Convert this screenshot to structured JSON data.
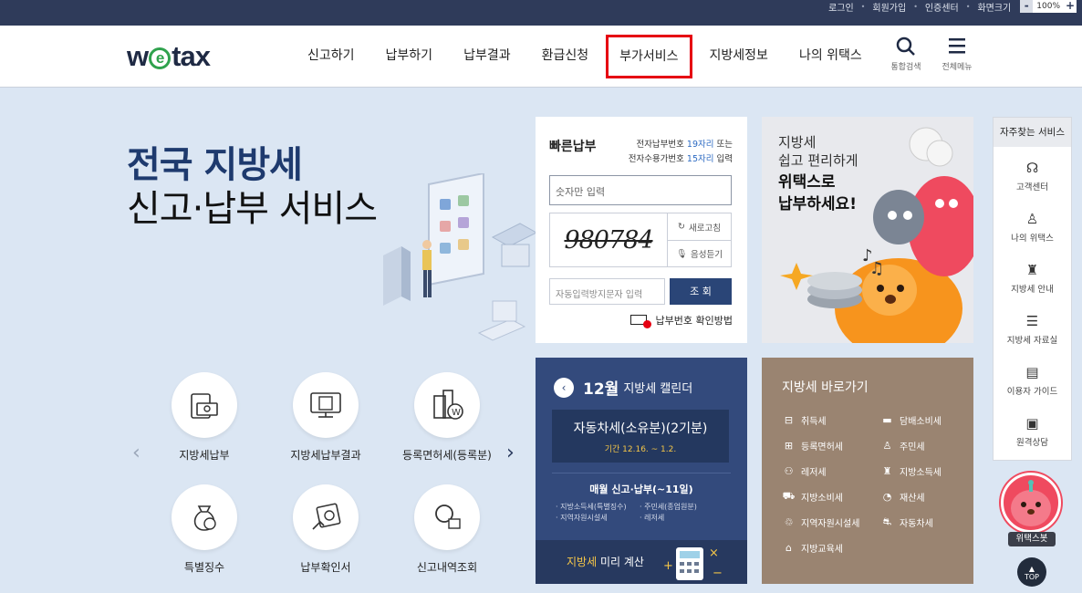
{
  "util_links": [
    "로그인",
    "회원가입",
    "인증센터",
    "화면크기"
  ],
  "zoom": {
    "minus": "-",
    "value": "100%",
    "plus": "+"
  },
  "logo": {
    "pre": "w",
    "e": "e",
    "post": "tax"
  },
  "nav": [
    "신고하기",
    "납부하기",
    "납부결과",
    "환급신청",
    "부가서비스",
    "지방세정보",
    "나의 위택스"
  ],
  "tools": {
    "search": "통합검색",
    "menu": "전체메뉴"
  },
  "hero": {
    "line1": "전국 지방세",
    "line2": "신고·납부 서비스"
  },
  "services": [
    "지방세납부",
    "지방세납부결과",
    "등록면허세(등록분)",
    "특별징수",
    "납부확인서",
    "신고내역조회"
  ],
  "quickpay": {
    "title": "빠른납부",
    "note1_pre": "전자납부번호 ",
    "note1_num": "19자리",
    "note1_post": " 또는",
    "note2_pre": "전자수용가번호 ",
    "note2_num": "15자리",
    "note2_post": " 입력",
    "input_placeholder": "숫자만 입력",
    "captcha_text": "980784",
    "refresh": "새로고침",
    "audio": "음성듣기",
    "captcha_placeholder": "자동입력방지문자 입력",
    "submit": "조 회",
    "help": "납부번호 확인방법"
  },
  "promo": {
    "line1": "지방세",
    "line2": "쉽고 편리하게",
    "line3": "위택스로",
    "line4": "납부하세요!"
  },
  "calendar": {
    "month": "12월",
    "title": "지방세 캘린더",
    "event_name": "자동차세(소유분)(2기분)",
    "event_period": "기간 12.16. ~ 1.2.",
    "monthly": "매월 신고·납부(~11일)",
    "items": [
      "지방소득세(특별징수)",
      "주민세(종업원분)",
      "지역자원시설세",
      "레저세"
    ],
    "footer_pre": "지방세",
    "footer_post": " 미리 계산"
  },
  "shortcut": {
    "title": "지방세 바로가기",
    "items": [
      "취득세",
      "담배소비세",
      "등록면허세",
      "주민세",
      "레저세",
      "지방소득세",
      "지방소비세",
      "재산세",
      "지역자원시설세",
      "자동차세",
      "지방교육세"
    ]
  },
  "sidebar": {
    "title": "자주찾는 서비스",
    "items": [
      "고객센터",
      "나의 위택스",
      "지방세 안내",
      "지방세 자료실",
      "이용자 가이드",
      "원격상담"
    ]
  },
  "bot_label": "위택스봇",
  "top_label": "TOP"
}
